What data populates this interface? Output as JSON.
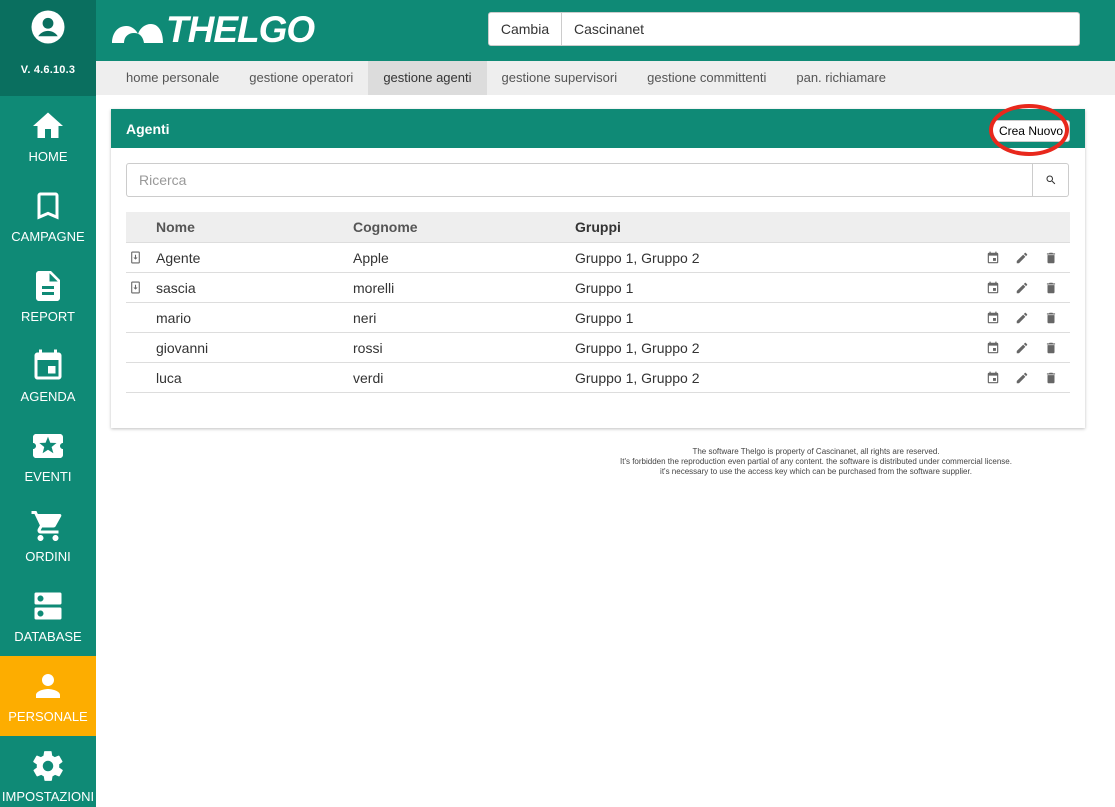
{
  "app": {
    "name": "THELGO",
    "version": "V. 4.6.10.3"
  },
  "colors": {
    "primary": "#0f8a76",
    "primary_dark": "#0a6f5f",
    "active_nav": "#fdad00",
    "highlight_ring": "#e8281c"
  },
  "header": {
    "switch_label": "Cambia",
    "account_value": "Cascinanet"
  },
  "sidebar": {
    "items": [
      {
        "label": "HOME",
        "icon": "home-icon"
      },
      {
        "label": "CAMPAGNE",
        "icon": "bookmark-icon"
      },
      {
        "label": "REPORT",
        "icon": "document-icon"
      },
      {
        "label": "AGENDA",
        "icon": "calendar-icon"
      },
      {
        "label": "EVENTI",
        "icon": "ticket-icon"
      },
      {
        "label": "ORDINI",
        "icon": "cart-icon"
      },
      {
        "label": "DATABASE",
        "icon": "database-icon"
      },
      {
        "label": "PERSONALE",
        "icon": "person-icon",
        "active": true
      },
      {
        "label": "IMPOSTAZIONI",
        "icon": "gear-icon"
      }
    ]
  },
  "tabs": [
    {
      "label": "home personale"
    },
    {
      "label": "gestione operatori"
    },
    {
      "label": "gestione agenti",
      "active": true
    },
    {
      "label": "gestione supervisori"
    },
    {
      "label": "gestione committenti"
    },
    {
      "label": "pan. richiamare"
    }
  ],
  "panel": {
    "title": "Agenti",
    "new_button": "Crea Nuovo",
    "search_placeholder": "Ricerca",
    "columns": {
      "nome": "Nome",
      "cognome": "Cognome",
      "gruppi": "Gruppi"
    },
    "rows": [
      {
        "nome": "Agente",
        "cognome": "Apple",
        "gruppi": "Gruppo 1, Gruppo 2",
        "has_device_icon": true
      },
      {
        "nome": "sascia",
        "cognome": "morelli",
        "gruppi": "Gruppo 1",
        "has_device_icon": true
      },
      {
        "nome": "mario",
        "cognome": "neri",
        "gruppi": "Gruppo 1",
        "has_device_icon": false
      },
      {
        "nome": "giovanni",
        "cognome": "rossi",
        "gruppi": "Gruppo 1, Gruppo 2",
        "has_device_icon": false
      },
      {
        "nome": "luca",
        "cognome": "verdi",
        "gruppi": "Gruppo 1, Gruppo 2",
        "has_device_icon": false
      }
    ]
  },
  "footer": {
    "lines": [
      "The software Thelgo is property of Cascinanet, all rights are reserved.",
      "It's forbidden the reproduction even partial of any content. the software is distributed under commercial license.",
      "it's necessary to use the access key which can be purchased from the software supplier."
    ]
  }
}
